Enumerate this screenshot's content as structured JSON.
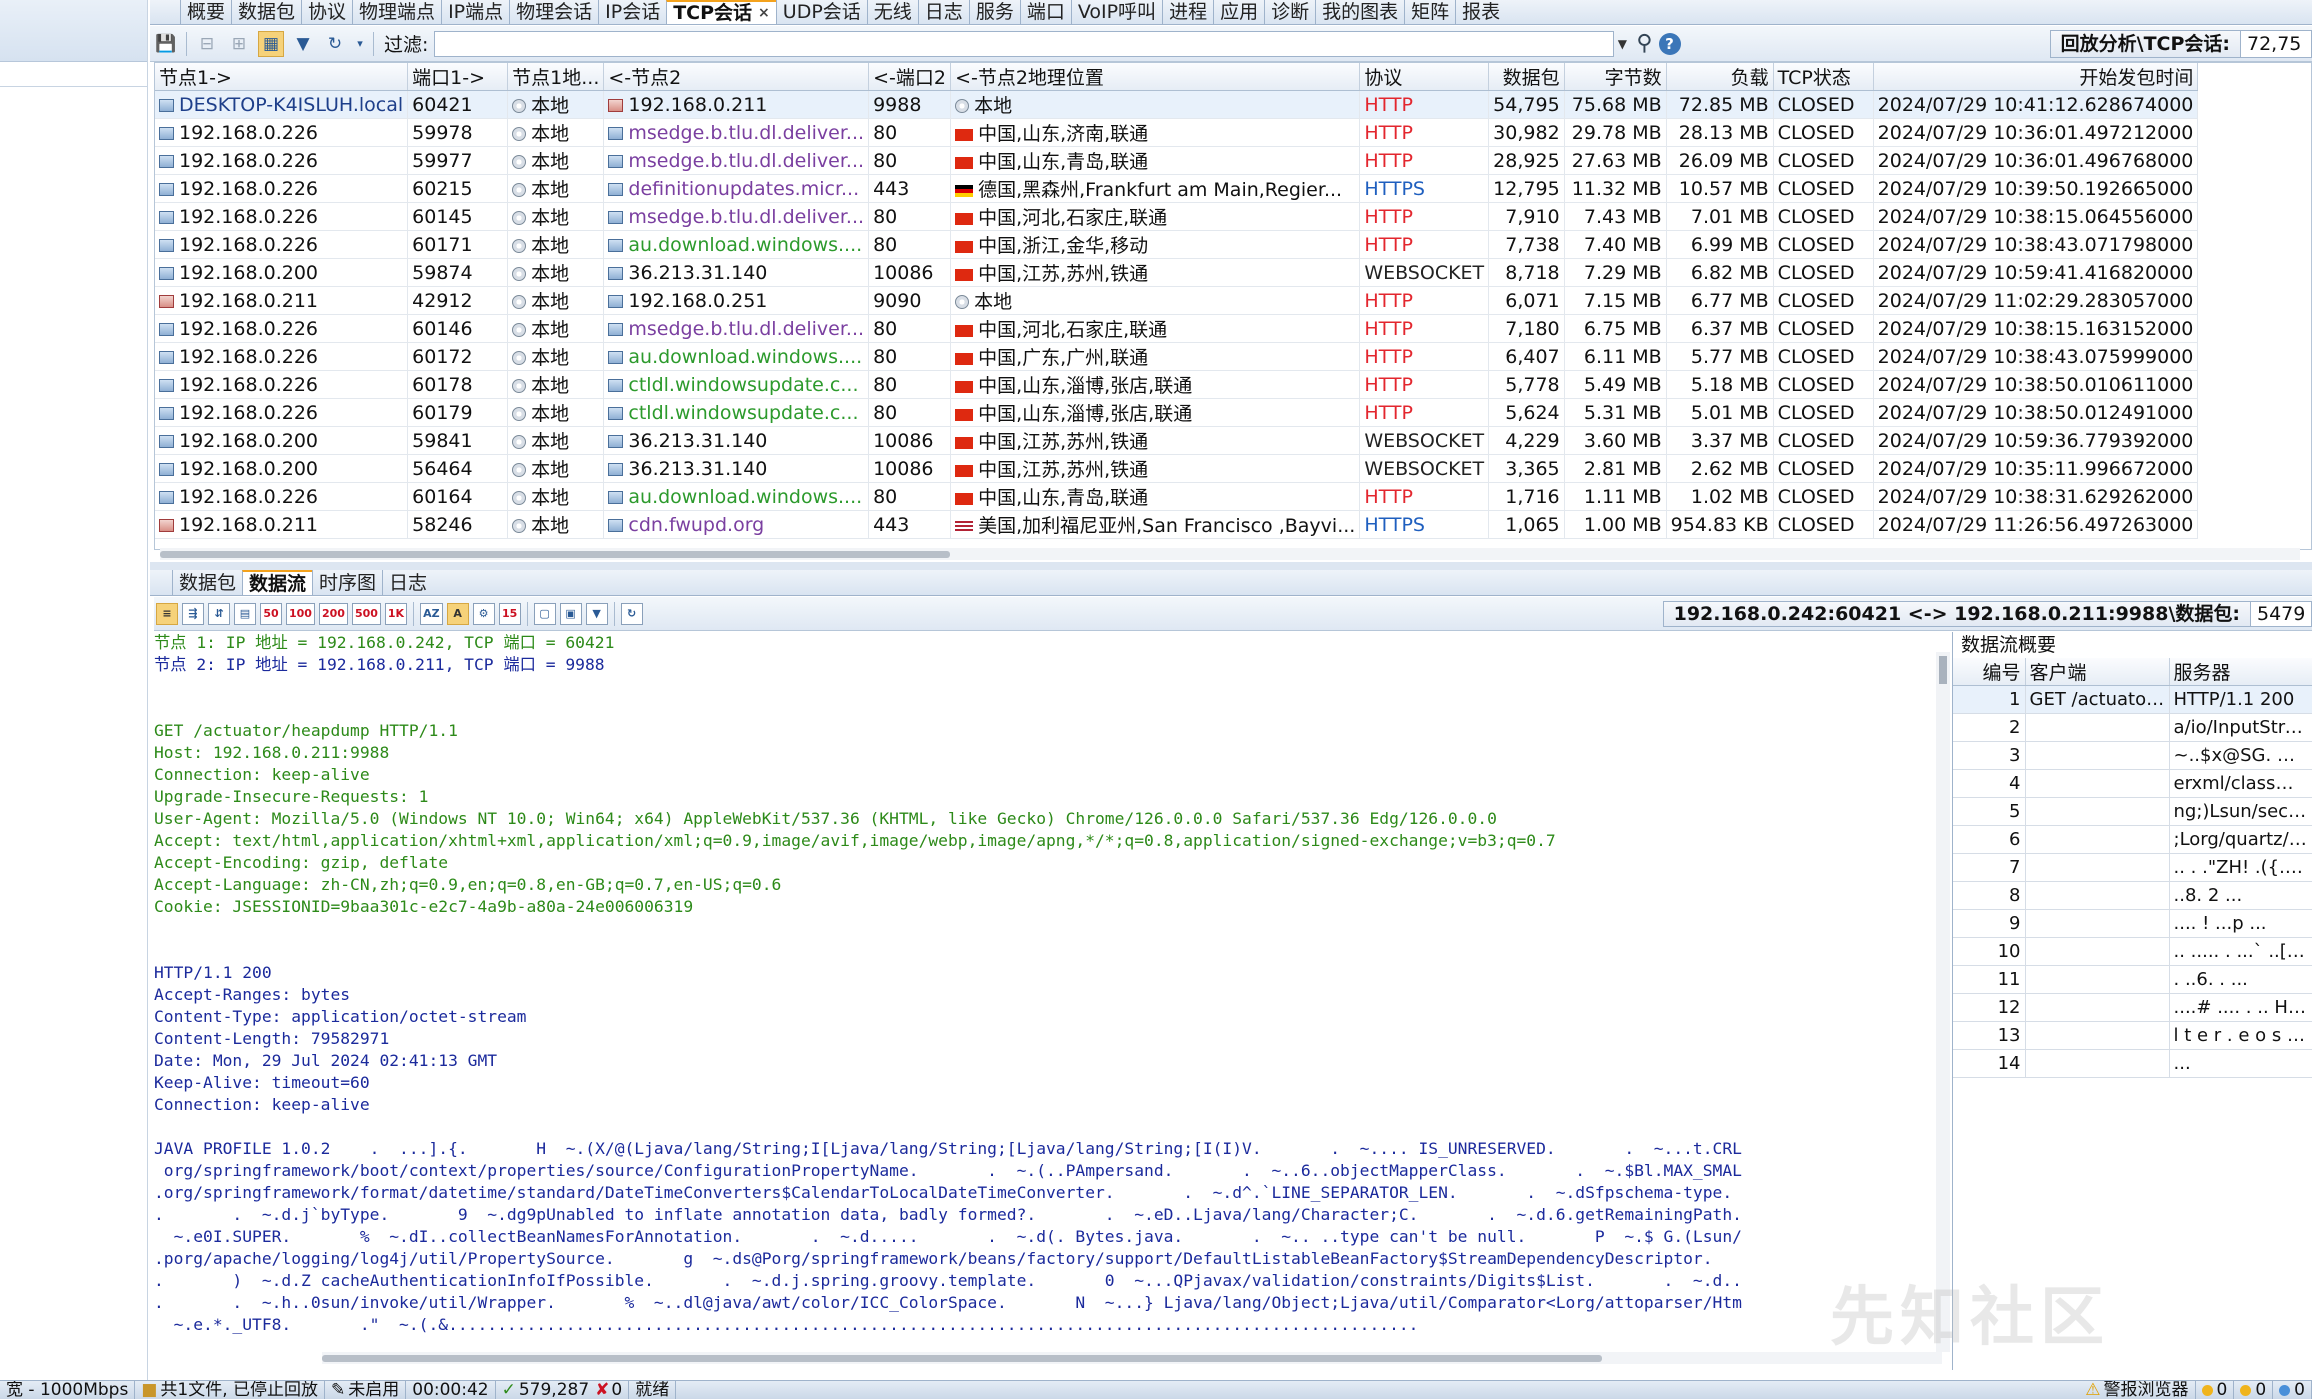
{
  "top_tabs": [
    "概要",
    "数据包",
    "协议",
    "物理端点",
    "IP端点",
    "物理会话",
    "IP会话",
    "TCP会话",
    "UDP会话",
    "无线",
    "日志",
    "服务",
    "端口",
    "VoIP呼叫",
    "进程",
    "应用",
    "诊断",
    "我的图表",
    "矩阵",
    "报表"
  ],
  "active_tab_index": 7,
  "filter": {
    "label": "过滤:",
    "value": ""
  },
  "replay": {
    "label": "回放分析\\TCP会话:",
    "value": "72,75"
  },
  "columns": [
    "节点1->",
    "端口1->",
    "节点1地...",
    "<-节点2",
    "<-端口2",
    "<-节点2地理位置",
    "协议",
    "数据包",
    "字节数",
    "负载",
    "TCP状态",
    "开始发包时间"
  ],
  "rows": [
    {
      "n1": "DESKTOP-K4ISLUH.local",
      "p1": "60421",
      "geo1": "本地",
      "n2": "192.168.0.211",
      "p2": "9988",
      "geo2": "本地",
      "proto": "HTTP",
      "pkts": "54,795",
      "bytes": "75.68 MB",
      "load": "72.85 MB",
      "state": "CLOSED",
      "time": "2024/07/29 10:41:12.628674000",
      "sel": true,
      "n1red": false,
      "n2kind": "ip-red",
      "flag": "globe"
    },
    {
      "n1": "192.168.0.226",
      "p1": "59978",
      "geo1": "本地",
      "n2": "msedge.b.tlu.dl.deliver...",
      "p2": "80",
      "geo2": "中国,山东,济南,联通",
      "proto": "HTTP",
      "pkts": "30,982",
      "bytes": "29.78 MB",
      "load": "28.13 MB",
      "state": "CLOSED",
      "time": "2024/07/29 10:36:01.497212000",
      "n2kind": "purple",
      "flag": "cn"
    },
    {
      "n1": "192.168.0.226",
      "p1": "59977",
      "geo1": "本地",
      "n2": "msedge.b.tlu.dl.deliver...",
      "p2": "80",
      "geo2": "中国,山东,青岛,联通",
      "proto": "HTTP",
      "pkts": "28,925",
      "bytes": "27.63 MB",
      "load": "26.09 MB",
      "state": "CLOSED",
      "time": "2024/07/29 10:36:01.496768000",
      "n2kind": "purple",
      "flag": "cn"
    },
    {
      "n1": "192.168.0.226",
      "p1": "60215",
      "geo1": "本地",
      "n2": "definitionupdates.micr...",
      "p2": "443",
      "geo2": "德国,黑森州,Frankfurt am Main,Regier...",
      "proto": "HTTPS",
      "pkts": "12,795",
      "bytes": "11.32 MB",
      "load": "10.57 MB",
      "state": "CLOSED",
      "time": "2024/07/29 10:39:50.192665000",
      "n2kind": "purple",
      "flag": "de"
    },
    {
      "n1": "192.168.0.226",
      "p1": "60145",
      "geo1": "本地",
      "n2": "msedge.b.tlu.dl.deliver...",
      "p2": "80",
      "geo2": "中国,河北,石家庄,联通",
      "proto": "HTTP",
      "pkts": "7,910",
      "bytes": "7.43 MB",
      "load": "7.01 MB",
      "state": "CLOSED",
      "time": "2024/07/29 10:38:15.064556000",
      "n2kind": "purple",
      "flag": "cn"
    },
    {
      "n1": "192.168.0.226",
      "p1": "60171",
      "geo1": "本地",
      "n2": "au.download.windows....",
      "p2": "80",
      "geo2": "中国,浙江,金华,移动",
      "proto": "HTTP",
      "pkts": "7,738",
      "bytes": "7.40 MB",
      "load": "6.99 MB",
      "state": "CLOSED",
      "time": "2024/07/29 10:38:43.071798000",
      "n2kind": "green",
      "flag": "cn"
    },
    {
      "n1": "192.168.0.200",
      "p1": "59874",
      "geo1": "本地",
      "n2": "36.213.31.140",
      "p2": "10086",
      "geo2": "中国,江苏,苏州,铁通",
      "proto": "WEBSOCKET",
      "pkts": "8,718",
      "bytes": "7.29 MB",
      "load": "6.82 MB",
      "state": "CLOSED",
      "time": "2024/07/29 10:59:41.416820000",
      "n2kind": "ip",
      "flag": "cn"
    },
    {
      "n1": "192.168.0.211",
      "p1": "42912",
      "geo1": "本地",
      "n2": "192.168.0.251",
      "p2": "9090",
      "geo2": "本地",
      "proto": "HTTP",
      "pkts": "6,071",
      "bytes": "7.15 MB",
      "load": "6.77 MB",
      "state": "CLOSED",
      "time": "2024/07/29 11:02:29.283057000",
      "n1red": true,
      "n2kind": "ip",
      "flag": "globe"
    },
    {
      "n1": "192.168.0.226",
      "p1": "60146",
      "geo1": "本地",
      "n2": "msedge.b.tlu.dl.deliver...",
      "p2": "80",
      "geo2": "中国,河北,石家庄,联通",
      "proto": "HTTP",
      "pkts": "7,180",
      "bytes": "6.75 MB",
      "load": "6.37 MB",
      "state": "CLOSED",
      "time": "2024/07/29 10:38:15.163152000",
      "n2kind": "purple",
      "flag": "cn"
    },
    {
      "n1": "192.168.0.226",
      "p1": "60172",
      "geo1": "本地",
      "n2": "au.download.windows....",
      "p2": "80",
      "geo2": "中国,广东,广州,联通",
      "proto": "HTTP",
      "pkts": "6,407",
      "bytes": "6.11 MB",
      "load": "5.77 MB",
      "state": "CLOSED",
      "time": "2024/07/29 10:38:43.075999000",
      "n2kind": "green",
      "flag": "cn"
    },
    {
      "n1": "192.168.0.226",
      "p1": "60178",
      "geo1": "本地",
      "n2": "ctldl.windowsupdate.c...",
      "p2": "80",
      "geo2": "中国,山东,淄博,张店,联通",
      "proto": "HTTP",
      "pkts": "5,778",
      "bytes": "5.49 MB",
      "load": "5.18 MB",
      "state": "CLOSED",
      "time": "2024/07/29 10:38:50.010611000",
      "n2kind": "green",
      "flag": "cn"
    },
    {
      "n1": "192.168.0.226",
      "p1": "60179",
      "geo1": "本地",
      "n2": "ctldl.windowsupdate.c...",
      "p2": "80",
      "geo2": "中国,山东,淄博,张店,联通",
      "proto": "HTTP",
      "pkts": "5,624",
      "bytes": "5.31 MB",
      "load": "5.01 MB",
      "state": "CLOSED",
      "time": "2024/07/29 10:38:50.012491000",
      "n2kind": "green",
      "flag": "cn"
    },
    {
      "n1": "192.168.0.200",
      "p1": "59841",
      "geo1": "本地",
      "n2": "36.213.31.140",
      "p2": "10086",
      "geo2": "中国,江苏,苏州,铁通",
      "proto": "WEBSOCKET",
      "pkts": "4,229",
      "bytes": "3.60 MB",
      "load": "3.37 MB",
      "state": "CLOSED",
      "time": "2024/07/29 10:59:36.779392000",
      "n2kind": "ip",
      "flag": "cn"
    },
    {
      "n1": "192.168.0.200",
      "p1": "56464",
      "geo1": "本地",
      "n2": "36.213.31.140",
      "p2": "10086",
      "geo2": "中国,江苏,苏州,铁通",
      "proto": "WEBSOCKET",
      "pkts": "3,365",
      "bytes": "2.81 MB",
      "load": "2.62 MB",
      "state": "CLOSED",
      "time": "2024/07/29 10:35:11.996672000",
      "n2kind": "ip",
      "flag": "cn"
    },
    {
      "n1": "192.168.0.226",
      "p1": "60164",
      "geo1": "本地",
      "n2": "au.download.windows....",
      "p2": "80",
      "geo2": "中国,山东,青岛,联通",
      "proto": "HTTP",
      "pkts": "1,716",
      "bytes": "1.11 MB",
      "load": "1.02 MB",
      "state": "CLOSED",
      "time": "2024/07/29 10:38:31.629262000",
      "n2kind": "green",
      "flag": "cn"
    },
    {
      "n1": "192.168.0.211",
      "p1": "58246",
      "geo1": "本地",
      "n2": "cdn.fwupd.org",
      "p2": "443",
      "geo2": "美国,加利福尼亚州,San Francisco ,Bayvi...",
      "proto": "HTTPS",
      "pkts": "1,065",
      "bytes": "1.00 MB",
      "load": "954.83 KB",
      "state": "CLOSED",
      "time": "2024/07/29 11:26:56.497263000",
      "n1red": true,
      "n2kind": "purple",
      "flag": "us"
    }
  ],
  "sub_tabs": [
    "数据包",
    "数据流",
    "时序图",
    "日志"
  ],
  "active_sub_tab_index": 1,
  "flow_header": {
    "label": "192.168.0.242:60421 <-> 192.168.0.211:9988\\数据包:",
    "value": "5479"
  },
  "stream_lines": [
    {
      "c": "g",
      "t": "节点 1: IP 地址 = 192.168.0.242, TCP 端口 = 60421"
    },
    {
      "c": "b",
      "t": "节点 2: IP 地址 = 192.168.0.211, TCP 端口 = 9988"
    },
    {
      "c": "g",
      "t": ""
    },
    {
      "c": "g",
      "t": ""
    },
    {
      "c": "g",
      "t": "GET /actuator/heapdump HTTP/1.1"
    },
    {
      "c": "g",
      "t": "Host: 192.168.0.211:9988"
    },
    {
      "c": "g",
      "t": "Connection: keep-alive"
    },
    {
      "c": "g",
      "t": "Upgrade-Insecure-Requests: 1"
    },
    {
      "c": "g",
      "t": "User-Agent: Mozilla/5.0 (Windows NT 10.0; Win64; x64) AppleWebKit/537.36 (KHTML, like Gecko) Chrome/126.0.0.0 Safari/537.36 Edg/126.0.0.0"
    },
    {
      "c": "g",
      "t": "Accept: text/html,application/xhtml+xml,application/xml;q=0.9,image/avif,image/webp,image/apng,*/*;q=0.8,application/signed-exchange;v=b3;q=0.7"
    },
    {
      "c": "g",
      "t": "Accept-Encoding: gzip, deflate"
    },
    {
      "c": "g",
      "t": "Accept-Language: zh-CN,zh;q=0.9,en;q=0.8,en-GB;q=0.7,en-US;q=0.6"
    },
    {
      "c": "g",
      "t": "Cookie: JSESSIONID=9baa301c-e2c7-4a9b-a80a-24e006006319"
    },
    {
      "c": "g",
      "t": ""
    },
    {
      "c": "g",
      "t": ""
    },
    {
      "c": "b",
      "t": "HTTP/1.1 200"
    },
    {
      "c": "b",
      "t": "Accept-Ranges: bytes"
    },
    {
      "c": "b",
      "t": "Content-Type: application/octet-stream"
    },
    {
      "c": "b",
      "t": "Content-Length: 79582971"
    },
    {
      "c": "b",
      "t": "Date: Mon, 29 Jul 2024 02:41:13 GMT"
    },
    {
      "c": "b",
      "t": "Keep-Alive: timeout=60"
    },
    {
      "c": "b",
      "t": "Connection: keep-alive"
    },
    {
      "c": "b",
      "t": ""
    },
    {
      "c": "b",
      "t": "JAVA PROFILE 1.0.2    .  ...].{.       H  ~.(X/@(Ljava/lang/String;I[Ljava/lang/String;[Ljava/lang/String;[I(I)V.       .  ~.... IS_UNRESERVED.       .  ~...t.CRL"
    },
    {
      "c": "b",
      "t": " org/springframework/boot/context/properties/source/ConfigurationPropertyName.       .  ~.(..PAmpersand.       .  ~..6..objectMapperClass.       .  ~.$Bl.MAX_SMAL"
    },
    {
      "c": "b",
      "t": ".org/springframework/format/datetime/standard/DateTimeConverters$CalendarToLocalDateTimeConverter.       .  ~.d^.`LINE_SEPARATOR_LEN.       .  ~.dSfpschema-type."
    },
    {
      "c": "b",
      "t": ".       .  ~.d.j`byType.       9  ~.dg9pUnabled to inflate annotation data, badly formed?.       .  ~.eD..Ljava/lang/Character;C.       .  ~.d.6.getRemainingPath."
    },
    {
      "c": "b",
      "t": "  ~.e0I.SUPER.       %  ~.dI..collectBeanNamesForAnnotation.       .  ~.d.....       .  ~.d(. Bytes.java.       .  ~.. ..type can't be null.       P  ~.$ G.(Lsun/"
    },
    {
      "c": "b",
      "t": ".porg/apache/logging/log4j/util/PropertySource.       g  ~.ds@Porg/springframework/beans/factory/support/DefaultListableBeanFactory$StreamDependencyDescriptor."
    },
    {
      "c": "b",
      "t": ".       )  ~.d.Z cacheAuthenticationInfoIfPossible.       .  ~.d.j.spring.groovy.template.       0  ~...QPjavax/validation/constraints/Digits$List.       .  ~.d.."
    },
    {
      "c": "b",
      "t": ".       .  ~.h..0sun/invoke/util/Wrapper.       %  ~..dl@java/awt/color/ICC_ColorSpace.       N  ~...} Ljava/lang/Object;Ljava/util/Comparator<Lorg/attoparser/Htm"
    },
    {
      "c": "b",
      "t": "  ~.e.*._UTF8.       .\"  ~.(.&..................................................................................................."
    }
  ],
  "summary": {
    "title": "数据流概要",
    "columns": [
      "编号",
      "客户端",
      "服务器"
    ],
    "rows": [
      {
        "n": "1",
        "client": "GET /actuator/heapd...",
        "server": "HTTP/1.1 200"
      },
      {
        "n": "2",
        "client": "",
        "server": "a/io/InputStream;Ljav..."
      },
      {
        "n": "3",
        "client": "",
        "server": "   ~..$x@SG.       ~.$...."
      },
      {
        "n": "4",
        "client": "",
        "server": "erxml/classmate/util/..."
      },
      {
        "n": "5",
        "client": "",
        "server": "ng;)Lsun/security/util..."
      },
      {
        "n": "6",
        "client": "",
        "server": ";Lorg/quartz/spi/Ope..."
      },
      {
        "n": "7",
        "client": "",
        "server": "  ..  .   .\"ZH!   .({.   ...."
      },
      {
        "n": "8",
        "client": "",
        "server": " ..8.   2                   ..."
      },
      {
        "n": "9",
        "client": "",
        "server": "               ....     !    ...p ..."
      },
      {
        "n": "10",
        "client": "",
        "server": "..  .....   .      ...`   ..[H! ..."
      },
      {
        "n": "11",
        "client": "",
        "server": "    .    ..6.   .              ..."
      },
      {
        "n": "12",
        "client": "",
        "server": "     ....#    ....   .   .. H T T P ..."
      },
      {
        "n": "13",
        "client": "",
        "server": "  l t e r . e o s !     ....   .   ..."
      },
      {
        "n": "14",
        "client": "",
        "server": "                                  ..."
      }
    ]
  },
  "watermark": "先知社区",
  "statusbar": {
    "speed": "宽 - 1000Mbps",
    "files": "共1文件, 已停止回放",
    "enabled": "未启用",
    "elapsed": "00:00:42",
    "count": "579,287",
    "zero": "0",
    "ready": "就绪",
    "alert": "警报浏览器",
    "a1": "0",
    "a2": "0",
    "a3": "0"
  },
  "colors": {
    "accent": "#f4a21c",
    "http": "#e3262e",
    "https": "#1f5fbf",
    "purple_host": "#7a3fa0",
    "green_host": "#2c9a2c",
    "stream_green": "#2d8a19",
    "stream_blue": "#1b2a9c"
  }
}
